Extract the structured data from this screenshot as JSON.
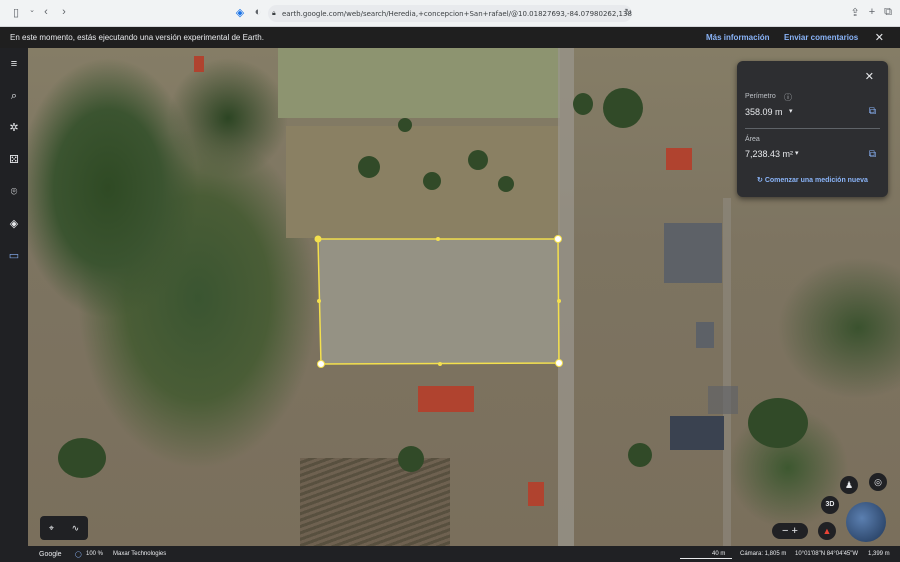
{
  "browser": {
    "url": "earth.google.com/web/search/Heredia,+concepcion+San+rafael/@10.01827693,-84.07980262,1387.97800",
    "icons": [
      "sidebar-toggle-icon",
      "back-icon",
      "forward-icon",
      "share-icon",
      "new-tab-icon",
      "tabs-icon"
    ]
  },
  "notice": {
    "text": "En este momento, estás ejecutando una versión experimental de Earth.",
    "more_info": "Más información",
    "feedback": "Enviar comentarios"
  },
  "measure_panel": {
    "perimeter_label": "Perímetro",
    "perimeter_value": "358.09 m",
    "area_label": "Área",
    "area_value": "7,238.43 m²",
    "new_measurement": "Comenzar una medición nueva"
  },
  "map_controls": {
    "view_3d": "3D"
  },
  "status_bar": {
    "brand": "Google",
    "zoom": "100 %",
    "attribution": "Maxar Technologies",
    "scale": "40 m",
    "camera": "Cámara: 1,805 m",
    "coords": "10°01'08\"N 84°04'45\"W",
    "elevation": "1,399 m"
  },
  "colors": {
    "accent": "#8ab4f8",
    "measure_line": "#f4e04d",
    "panel_bg": "#2d2e31"
  }
}
